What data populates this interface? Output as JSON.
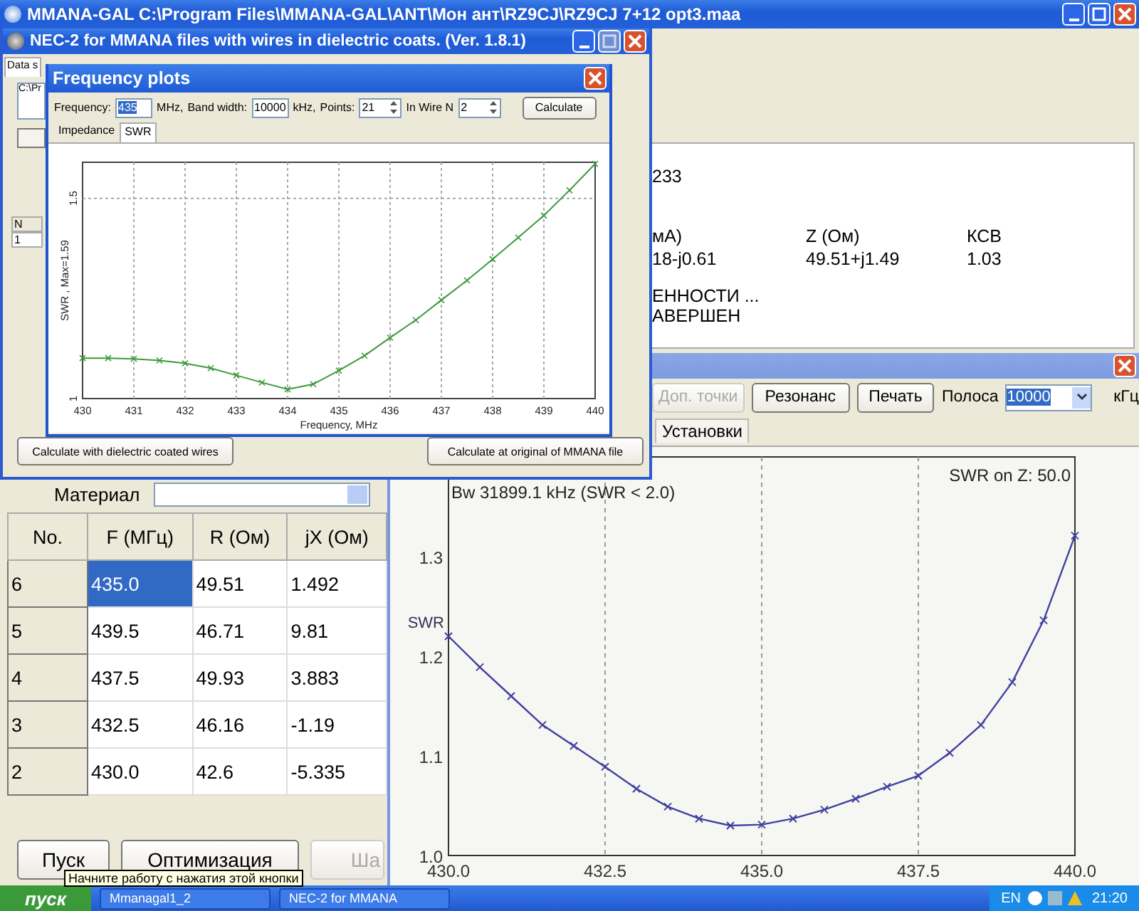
{
  "main_window": {
    "title": "MMANA-GAL C:\\Program Files\\MMANA-GAL\\ANT\\Мон ант\\RZ9CJ\\RZ9CJ 7+12 opt3.maa",
    "results": {
      "line": "233",
      "headers": [
        "мА)",
        "Z (Ом)",
        "КСВ"
      ],
      "values": [
        "18-j0.61",
        "49.51+j1.49",
        "1.03"
      ],
      "status": [
        "ЕННОСТИ ...",
        "АВЕРШЕН"
      ]
    },
    "material_label": "Материал",
    "table": {
      "columns": [
        "No.",
        "F (МГц)",
        "R (Ом)",
        "jX (Ом)"
      ],
      "rows": [
        {
          "cells": [
            {
              "text": "6",
              "selected": false
            },
            {
              "text": "435.0",
              "selected": true
            },
            {
              "text": "49.51",
              "selected": false
            },
            {
              "text": "1.492",
              "selected": false
            }
          ]
        },
        {
          "cells": [
            {
              "text": "5",
              "selected": false
            },
            {
              "text": "439.5",
              "selected": false
            },
            {
              "text": "46.71",
              "selected": false
            },
            {
              "text": "9.81",
              "selected": false
            }
          ]
        },
        {
          "cells": [
            {
              "text": "4",
              "selected": false
            },
            {
              "text": "437.5",
              "selected": false
            },
            {
              "text": "49.93",
              "selected": false
            },
            {
              "text": "3.883",
              "selected": false
            }
          ]
        },
        {
          "cells": [
            {
              "text": "3",
              "selected": false
            },
            {
              "text": "432.5",
              "selected": false
            },
            {
              "text": "46.16",
              "selected": false
            },
            {
              "text": "-1.19",
              "selected": false
            }
          ]
        },
        {
          "cells": [
            {
              "text": "2",
              "selected": false
            },
            {
              "text": "430.0",
              "selected": false
            },
            {
              "text": "42.6",
              "selected": false
            },
            {
              "text": "-5.335",
              "selected": false
            }
          ]
        }
      ]
    },
    "buttons": [
      {
        "label": "Пуск",
        "disabled": false
      },
      {
        "label": "Оптимизация",
        "disabled": false
      },
      {
        "label": "Ша",
        "disabled": true
      }
    ],
    "tooltip": "Начните работу с нажатия этой кнопки"
  },
  "nec_window": {
    "title": "NEC-2 for MMANA files with wires in dielectric coats. (Ver. 1.8.1)",
    "tabs": [
      {
        "label": "Data s",
        "selected": true
      }
    ],
    "path_field": "C:\\Pr",
    "mini_table": [
      "N",
      "1"
    ],
    "buttons": [
      "Calculate with dielectric coated wires",
      "Calculate at original of MMANA file"
    ]
  },
  "freq_window": {
    "title": "Frequency plots",
    "fields": [
      {
        "kind": "text",
        "label": "Frequency:",
        "value": "435",
        "unit": "MHz,",
        "highlighted": true
      },
      {
        "kind": "text",
        "label": "Band width:",
        "value": "10000",
        "unit": "kHz,",
        "highlighted": false
      },
      {
        "kind": "spin",
        "label": "Points:",
        "value": "21",
        "highlighted": false
      },
      {
        "kind": "spin",
        "label": "In Wire N",
        "value": "2",
        "highlighted": false
      }
    ],
    "calculate_button": "Calculate",
    "tabs": [
      {
        "label": "Impedance",
        "selected": false
      },
      {
        "label": "SWR",
        "selected": true
      }
    ],
    "chart_data": {
      "type": "line",
      "xlabel": "Frequency, MHz",
      "ylabel": "SWR , Max=1.59",
      "grid": true,
      "x": [
        430,
        430.5,
        431,
        431.5,
        432,
        432.5,
        433,
        433.5,
        434,
        434.5,
        435,
        435.5,
        436,
        436.5,
        437,
        437.5,
        438,
        438.5,
        439,
        439.5,
        440
      ],
      "series": [
        {
          "color": "#3c9a3c",
          "marker": "x",
          "values": [
            1.101,
            1.101,
            1.099,
            1.095,
            1.088,
            1.076,
            1.058,
            1.04,
            1.023,
            1.036,
            1.07,
            1.107,
            1.152,
            1.196,
            1.246,
            1.295,
            1.348,
            1.402,
            1.457,
            1.52,
            1.586
          ]
        }
      ],
      "xlim": [
        430,
        440
      ],
      "ylim": [
        1,
        1.59
      ],
      "xticks": [
        430,
        431,
        432,
        433,
        434,
        435,
        436,
        437,
        438,
        439,
        440
      ],
      "yticks": [
        1,
        1.5
      ]
    }
  },
  "swr_window": {
    "toolbar": [
      {
        "label": "Доп. точки",
        "disabled": true
      },
      {
        "label": "Резонанс",
        "disabled": false
      },
      {
        "label": "Печать",
        "disabled": false
      }
    ],
    "band": {
      "label": "Полоса",
      "value": "10000",
      "unit": "кГц"
    },
    "tabs": [
      {
        "label": "Установки",
        "selected": false
      }
    ],
    "bandwidth_note": "Bw 31899.1 kHz (SWR < 2.0)",
    "z_note": "SWR on Z: 50.0",
    "chart_data": {
      "type": "line",
      "grid": true,
      "x": [
        430,
        430.5,
        431,
        431.5,
        432,
        432.5,
        433,
        433.5,
        434,
        434.5,
        435,
        435.5,
        436,
        436.5,
        437,
        437.5,
        438,
        438.5,
        439,
        439.5,
        440
      ],
      "series": [
        {
          "name": "SWR",
          "color": "#4040a0",
          "marker": "x",
          "values": [
            1.22,
            1.189,
            1.16,
            1.131,
            1.11,
            1.089,
            1.067,
            1.049,
            1.037,
            1.03,
            1.031,
            1.037,
            1.046,
            1.057,
            1.069,
            1.08,
            1.103,
            1.131,
            1.174,
            1.236,
            1.321
          ]
        }
      ],
      "xlim": [
        430,
        440
      ],
      "ylim": [
        1.0,
        1.4
      ],
      "xticks": [
        {
          "value": 430,
          "label": "430.0"
        },
        {
          "value": 432.5,
          "label": "432.5"
        },
        {
          "value": 435,
          "label": "435.0"
        },
        {
          "value": 437.5,
          "label": "437.5"
        },
        {
          "value": 440,
          "label": "440.0"
        }
      ],
      "yticks": [
        {
          "value": 1.0,
          "label": "1.0"
        },
        {
          "value": 1.1,
          "label": "1.1"
        },
        {
          "value": 1.2,
          "label": "1.2"
        },
        {
          "value": 1.3,
          "label": "1.3"
        }
      ]
    }
  },
  "taskbar": {
    "start": "пуск",
    "tasks": [
      "Mmanagal1_2",
      "NEC-2 for MMANA"
    ],
    "language": "EN",
    "clock": "21:20"
  }
}
